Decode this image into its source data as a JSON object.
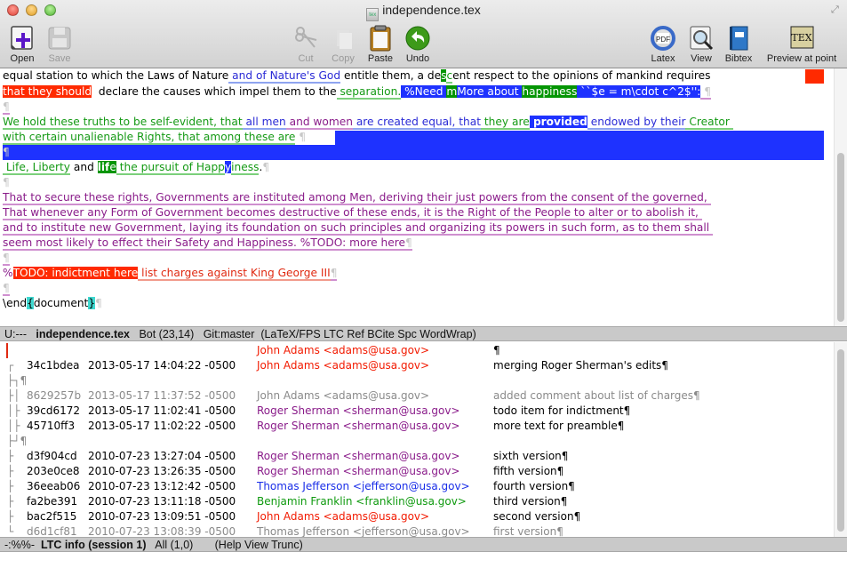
{
  "window": {
    "title": "independence.tex"
  },
  "toolbar": {
    "open": "Open",
    "save": "Save",
    "cut": "Cut",
    "copy": "Copy",
    "paste": "Paste",
    "undo": "Undo",
    "latex": "Latex",
    "view": "View",
    "bibtex": "Bibtex",
    "preview": "Preview at point",
    "latex_icon_text": "PDF",
    "preview_icon_text": "TEX"
  },
  "editor": {
    "lines": {
      "l1": {
        "a": "equal station to which the Laws of Nature",
        "b": " and of Nature's God",
        "c": " entitle them, a de",
        "d": "s",
        "e": "c",
        "f": "ent respect to the opinions of mankind requires"
      },
      "l2": {
        "a": "that they should",
        "b": "  declare the causes which impel them to the",
        "c": " separation.",
        "d": " %Need ",
        "e": "m",
        "f": "More about ",
        "g": "happiness",
        "h": " ``$e = m\\cdot c^2$'':",
        "i": " ¶"
      },
      "l3": {
        "a": "¶"
      },
      "l4": {
        "a": "We hold these truths to be self-evident, that",
        "b": " all men",
        "c": " and women",
        "d": " are created equal, that",
        "e": " they are",
        "f": " provided",
        "g": " endowed by their",
        "h": " Creator "
      },
      "l5": {
        "a": "with certain unalienable Rights, that among these are",
        "b": " ¶"
      },
      "l6": {
        "a": "¶"
      },
      "l7": {
        "a": " Life, Liberty",
        "b": " and ",
        "c": "lif",
        "d": "e",
        "e": " the pursuit of Happ",
        "f": "y",
        "g": "iness",
        "h": ".",
        "i": "¶"
      },
      "l8": {
        "a": "¶"
      },
      "l9": {
        "a": "That to secure these rights, Governments are instituted among Men, deriving their just powers from the consent of the governed, "
      },
      "l10": {
        "a": "That whenever any Form of Government becomes destructive of these ends, it is the Right of the People to alter or to abolish it, "
      },
      "l11": {
        "a": "and to institute new Government, laying its foundation on such principles and organizing its powers in such form, as to them shall "
      },
      "l12": {
        "a": "seem most likely to effect their Safety and Happiness. %TODO: more here",
        "b": "¶"
      },
      "l13": {
        "a": "¶"
      },
      "l14": {
        "a": "%",
        "b": "TODO: indictment here",
        "c": " list charges against King George III",
        "d": "¶"
      },
      "l15": {
        "a": "¶"
      },
      "l16": {
        "a": "\\end",
        "b": "{",
        "c": "document",
        "d": "}",
        "e": "¶"
      }
    }
  },
  "modeline_top": {
    "state": "U:---",
    "buffer": "independence.tex",
    "position": "Bot (23,14)",
    "vc": "Git:master",
    "modes": "(LaTeX/FPS LTC Ref BCite Spc WordWrap)"
  },
  "log": {
    "rows": [
      {
        "graph": "",
        "hash": "",
        "date": "",
        "author": "John Adams <adams@usa.gov>",
        "message": "¶",
        "author_color": "red",
        "dim": false
      },
      {
        "graph": "┌",
        "hash": "34c1bdea",
        "date": "2013-05-17 14:04:22 -0500",
        "author": "John Adams <adams@usa.gov>",
        "message": "merging Roger Sherman's edits¶",
        "author_color": "red",
        "dim": false
      },
      {
        "graph": "├┐¶",
        "hash": "",
        "date": "",
        "author": "",
        "message": "",
        "author_color": "",
        "dim": true
      },
      {
        "graph": "├│",
        "hash": "8629257b",
        "date": "2013-05-17 11:37:52 -0500",
        "author": "John Adams <adams@usa.gov>",
        "message": "added comment about list of charges¶",
        "author_color": "gray",
        "dim": true
      },
      {
        "graph": "│├",
        "hash": "39cd6172",
        "date": "2013-05-17 11:02:41 -0500",
        "author": "Roger Sherman <sherman@usa.gov>",
        "message": "todo item for indictment¶",
        "author_color": "purple",
        "dim": false
      },
      {
        "graph": "│├",
        "hash": "45710ff3",
        "date": "2013-05-17 11:02:22 -0500",
        "author": "Roger Sherman <sherman@usa.gov>",
        "message": "more text for preamble¶",
        "author_color": "purple",
        "dim": false
      },
      {
        "graph": "├┘¶",
        "hash": "",
        "date": "",
        "author": "",
        "message": "",
        "author_color": "",
        "dim": true
      },
      {
        "graph": "├",
        "hash": "d3f904cd",
        "date": "2010-07-23 13:27:04 -0500",
        "author": "Roger Sherman <sherman@usa.gov>",
        "message": "sixth version¶",
        "author_color": "purple",
        "dim": false
      },
      {
        "graph": "├",
        "hash": "203e0ce8",
        "date": "2010-07-23 13:26:35 -0500",
        "author": "Roger Sherman <sherman@usa.gov>",
        "message": "fifth version¶",
        "author_color": "purple",
        "dim": false
      },
      {
        "graph": "├",
        "hash": "36eeab06",
        "date": "2010-07-23 13:12:42 -0500",
        "author": "Thomas Jefferson <jefferson@usa.gov>",
        "message": "fourth version¶",
        "author_color": "blue",
        "dim": false
      },
      {
        "graph": "├",
        "hash": "fa2be391",
        "date": "2010-07-23 13:11:18 -0500",
        "author": "Benjamin Franklin <franklin@usa.gov>",
        "message": "third version¶",
        "author_color": "green",
        "dim": false
      },
      {
        "graph": "├",
        "hash": "bac2f515",
        "date": "2010-07-23 13:09:51 -0500",
        "author": "John Adams <adams@usa.gov>",
        "message": "second version¶",
        "author_color": "red",
        "dim": false
      },
      {
        "graph": "└",
        "hash": "d6d1cf81",
        "date": "2010-07-23 13:08:39 -0500",
        "author": "Thomas Jefferson <jefferson@usa.gov>",
        "message": "first version¶",
        "author_color": "gray",
        "dim": true
      }
    ]
  },
  "modeline_bottom": {
    "state": "-:%%-",
    "buffer": "LTC info (session 1)",
    "position": "All (1,0)",
    "modes": "(Help View Trunc)"
  },
  "colors": {
    "deletion_bg": "#ff2a00",
    "insertion_bg": "#1e32ff",
    "comment_bg": "#049504",
    "paren_match": "#3fd8d0",
    "adams": "#f21a00",
    "sherman": "#8a1c8a",
    "jefferson": "#1a2ee8",
    "franklin": "#0f9a0f"
  }
}
